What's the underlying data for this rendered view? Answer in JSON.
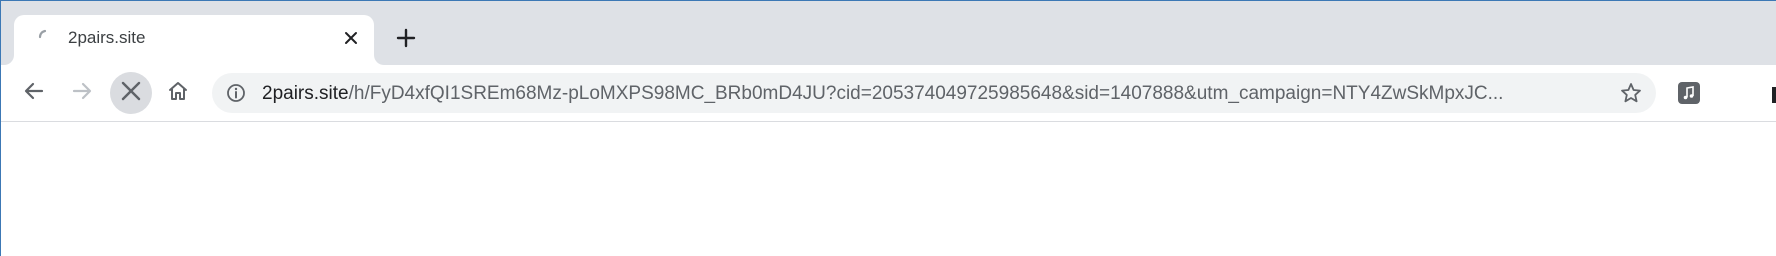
{
  "tab": {
    "title": "2pairs.site",
    "icon": "loading-spinner-icon",
    "close_icon": "close-icon"
  },
  "new_tab": {
    "icon": "plus-icon"
  },
  "toolbar": {
    "back_icon": "arrow-left-icon",
    "forward_icon": "arrow-right-icon",
    "stop_icon": "stop-x-icon",
    "home_icon": "home-icon"
  },
  "omnibox": {
    "info_icon": "info-icon",
    "url_host": "2pairs.site",
    "url_rest": "/h/FyD4xfQI1SREm68Mz-pLoMXPS98MC_BRb0mD4JU?cid=205374049725985648&sid=1407888&utm_campaign=NTY4ZwSkMpxJC...",
    "star_icon": "star-icon"
  },
  "extension": {
    "icon": "music-note-icon"
  },
  "colors": {
    "tabstrip_bg": "#dee1e6",
    "omnibox_bg": "#f1f3f4",
    "text": "#202124",
    "muted": "#5f6368"
  }
}
